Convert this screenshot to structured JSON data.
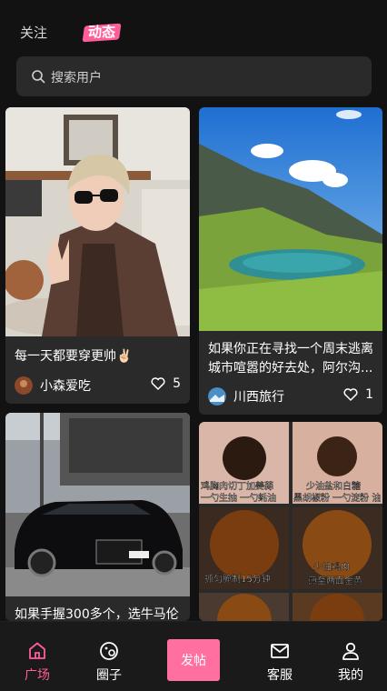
{
  "header": {
    "tab_follow": "关注",
    "tab_feed": "动态"
  },
  "search": {
    "placeholder": "搜索用户"
  },
  "feed": [
    {
      "title": "每一天都要穿更帅✌🏻",
      "author": "小森爱吃",
      "likes": "5",
      "image": "portrait"
    },
    {
      "title": "如果你正在寻找一个周末逃离城市喧嚣的好去处，阿尔沟...",
      "author": "川西旅行",
      "likes": "1",
      "image": "mountain lake"
    },
    {
      "title": "如果手握300多个，选牛马伦",
      "image": "black car"
    },
    {
      "overlay_texts": [
        "鸡胸肉切丁加姜蒜",
        "一勺生抽 一勺蚝油",
        "少油盐和白糖",
        "黑胡椒粉 一勺淀粉 油",
        "抓匀腌制15分钟",
        "少油鸡肉",
        "煎至两面金黄"
      ],
      "image": "cooking chicken collage"
    }
  ],
  "nav": {
    "items": [
      {
        "label": "广场",
        "icon": "home-icon",
        "active": true
      },
      {
        "label": "圈子",
        "icon": "circle-icon"
      },
      {
        "label": "发帖",
        "icon": "post-button"
      },
      {
        "label": "客服",
        "icon": "mail-icon"
      },
      {
        "label": "我的",
        "icon": "user-icon"
      }
    ]
  },
  "colors": {
    "accent": "#ff6f9f",
    "background": "#121212",
    "card": "#2a2a2a"
  }
}
